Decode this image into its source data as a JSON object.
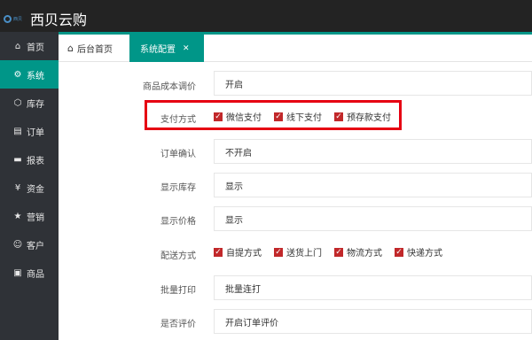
{
  "app": {
    "title": "西贝云购",
    "logo_text": "西贝"
  },
  "sidebar": {
    "items": [
      {
        "label": "首页",
        "icon": "home-icon",
        "glyph": "⌂",
        "active": false
      },
      {
        "label": "系统",
        "icon": "gear-icon",
        "glyph": "⚙",
        "active": true
      },
      {
        "label": "库存",
        "icon": "box-icon",
        "glyph": "⬡",
        "active": false
      },
      {
        "label": "订单",
        "icon": "document-icon",
        "glyph": "▤",
        "active": false
      },
      {
        "label": "报表",
        "icon": "chart-icon",
        "glyph": "▬",
        "active": false
      },
      {
        "label": "资金",
        "icon": "yen-icon",
        "glyph": "¥",
        "active": false
      },
      {
        "label": "营销",
        "icon": "star-icon",
        "glyph": "★",
        "active": false
      },
      {
        "label": "客户",
        "icon": "user-icon",
        "glyph": "☺",
        "active": false
      },
      {
        "label": "商品",
        "icon": "goods-icon",
        "glyph": "▣",
        "active": false
      }
    ]
  },
  "tabs": {
    "home_label": "后台首页",
    "active_label": "系统配置",
    "close_glyph": "✕"
  },
  "form": {
    "cost_price": {
      "label": "商品成本调价",
      "value": "开启"
    },
    "payment": {
      "label": "支付方式",
      "options": [
        {
          "label": "微信支付",
          "checked": true
        },
        {
          "label": "线下支付",
          "checked": true
        },
        {
          "label": "预存款支付",
          "checked": true
        }
      ]
    },
    "order_confirm": {
      "label": "订单确认",
      "value": "不开启"
    },
    "show_stock": {
      "label": "显示库存",
      "value": "显示"
    },
    "show_price": {
      "label": "显示价格",
      "value": "显示"
    },
    "delivery": {
      "label": "配送方式",
      "options": [
        {
          "label": "自提方式",
          "checked": true
        },
        {
          "label": "送货上门",
          "checked": true
        },
        {
          "label": "物流方式",
          "checked": true
        },
        {
          "label": "快递方式",
          "checked": true
        }
      ]
    },
    "batch_print": {
      "label": "批量打印",
      "value": "批量连打"
    },
    "review": {
      "label": "是否评价",
      "value": "开启订单评价"
    }
  },
  "colors": {
    "accent": "#009688",
    "topbar": "#232323",
    "sidebar": "#2f3237",
    "checkbox": "#c1282a",
    "highlight": "#e60012"
  }
}
